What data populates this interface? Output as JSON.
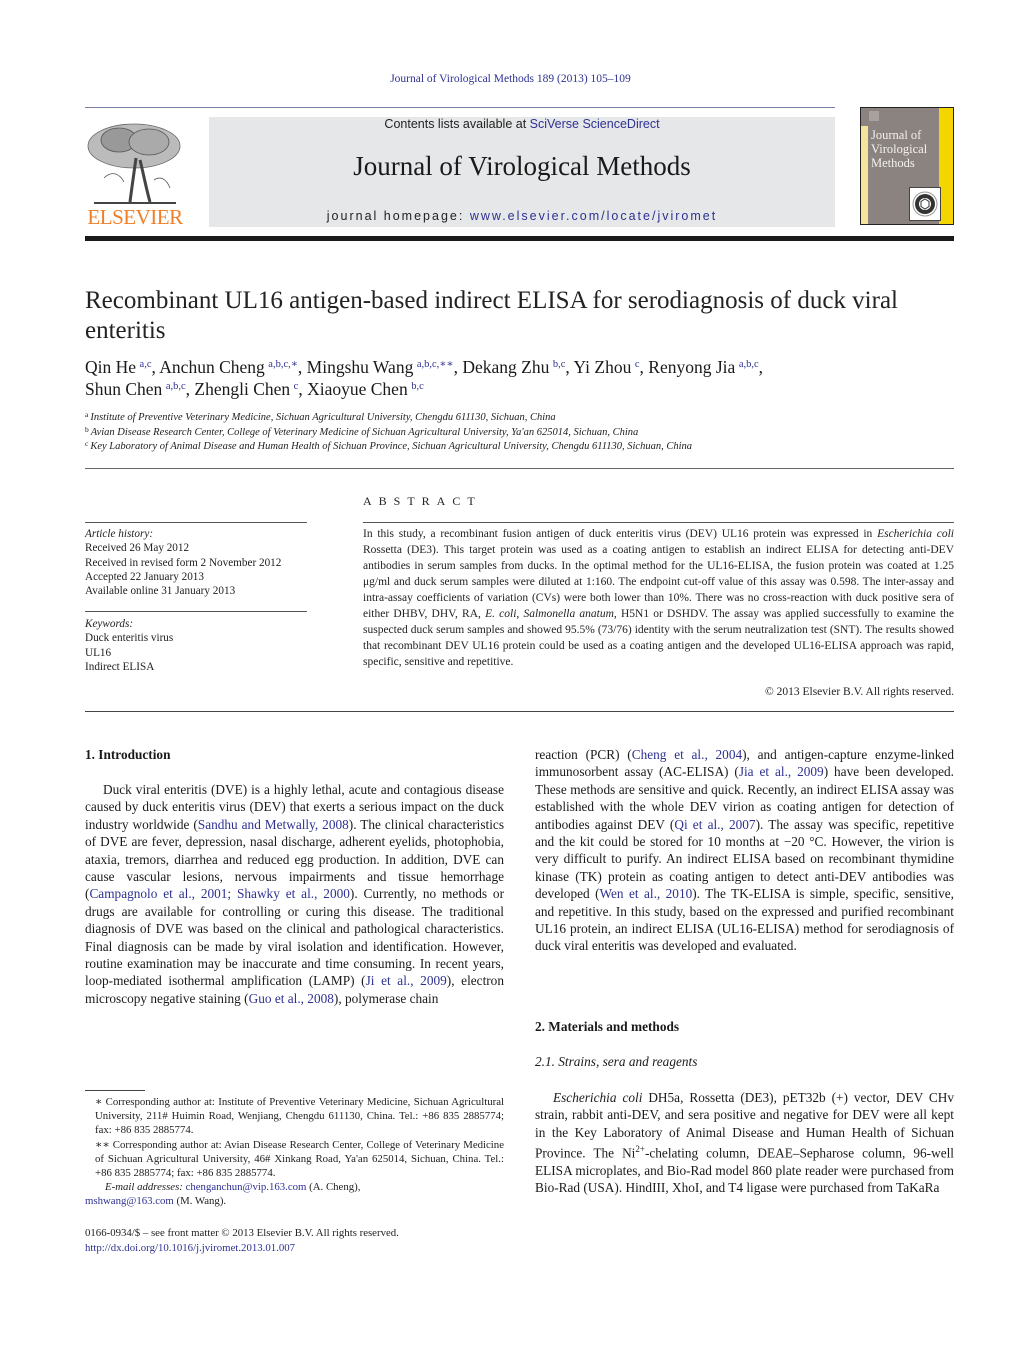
{
  "header": {
    "journal_ref": "Journal of Virological Methods 189 (2013) 105–109",
    "publisher_wordmark": "ELSEVIER",
    "contents_prefix": "Contents lists available at ",
    "contents_link": "SciVerse ScienceDirect",
    "journal_title": "Journal of Virological Methods",
    "homepage_prefix": "journal homepage: ",
    "homepage_url": "www.elsevier.com/locate/jviromet",
    "cover_title": "Journal of Virological Methods",
    "colors": {
      "link": "#2e3192",
      "elsevier_orange": "#f07e26",
      "masthead_bg": "#e6e7e8",
      "cover_yellow": "#f5d500"
    }
  },
  "article": {
    "title": "Recombinant UL16 antigen-based indirect ELISA for serodiagnosis of duck viral enteritis",
    "authors": [
      {
        "name": "Qin He",
        "sup": "a,c",
        "sep": ", "
      },
      {
        "name": "Anchun Cheng",
        "sup": "a,b,c,∗",
        "sep": ", "
      },
      {
        "name": "Mingshu Wang",
        "sup": "a,b,c,∗∗",
        "sep": ", "
      },
      {
        "name": "Dekang Zhu",
        "sup": "b,c",
        "sep": ", "
      },
      {
        "name": "Yi Zhou",
        "sup": "c",
        "sep": ", "
      },
      {
        "name": "Renyong Jia",
        "sup": "a,b,c",
        "sep": ", "
      },
      {
        "name": "Shun Chen",
        "sup": "a,b,c",
        "sep": ", "
      },
      {
        "name": "Zhengli Chen",
        "sup": "c",
        "sep": ", "
      },
      {
        "name": "Xiaoyue Chen",
        "sup": "b,c",
        "sep": ""
      }
    ],
    "affiliations": [
      {
        "key": "a",
        "text": "Institute of Preventive Veterinary Medicine, Sichuan Agricultural University, Chengdu 611130, Sichuan, China"
      },
      {
        "key": "b",
        "text": "Avian Disease Research Center, College of Veterinary Medicine of Sichuan Agricultural University, Ya'an 625014, Sichuan, China"
      },
      {
        "key": "c",
        "text": "Key Laboratory of Animal Disease and Human Health of Sichuan Province, Sichuan Agricultural University, Chengdu 611130, Sichuan, China"
      }
    ]
  },
  "article_info": {
    "history_label": "Article history:",
    "history": [
      "Received 26 May 2012",
      "Received in revised form 2 November 2012",
      "Accepted 22 January 2013",
      "Available online 31 January 2013"
    ],
    "keywords_label": "Keywords:",
    "keywords": [
      "Duck enteritis virus",
      "UL16",
      "Indirect ELISA"
    ]
  },
  "abstract": {
    "heading": "ABSTRACT",
    "text_1": "In this study, a recombinant fusion antigen of duck enteritis virus (DEV) UL16 protein was expressed in ",
    "text_1_italic": "Escherichia coli",
    "text_2": " Rossetta (DE3). This target protein was used as a coating antigen to establish an indirect ELISA for detecting anti-DEV antibodies in serum samples from ducks. In the optimal method for the UL16-ELISA, the fusion protein was coated at 1.25 μg/ml and duck serum samples were diluted at 1:160. The endpoint cut-off value of this assay was 0.598. The inter-assay and intra-assay coefficients of variation (CVs) were both lower than 10%. There was no cross-reaction with duck positive sera of either DHBV, DHV, RA, ",
    "text_2_italic_a": "E. coli",
    "text_2b": ", ",
    "text_2_italic_b": "Salmonella anatum",
    "text_3": ", H5N1 or DSHDV. The assay was applied successfully to examine the suspected duck serum samples and showed 95.5% (73/76) identity with the serum neutralization test (SNT). The results showed that recombinant DEV UL16 protein could be used as a coating antigen and the developed UL16-ELISA approach was rapid, specific, sensitive and repetitive.",
    "copyright": "© 2013 Elsevier B.V. All rights reserved."
  },
  "body": {
    "intro_heading": "1.  Introduction",
    "intro_p1_a": "Duck viral enteritis (DVE) is a highly lethal, acute and contagious disease caused by duck enteritis virus (DEV) that exerts a serious impact on the duck industry worldwide (",
    "cite_sandhu": "Sandhu and Metwally, 2008",
    "intro_p1_b": "). The clinical characteristics of DVE are fever, depression, nasal discharge, adherent eyelids, photophobia, ataxia, tremors, diarrhea and reduced egg production. In addition, DVE can cause vascular lesions, nervous impairments and tissue hemorrhage (",
    "cite_campagnolo": "Campagnolo et al., 2001; Shawky et al., 2000",
    "intro_p1_c": "). Currently, no methods or drugs are available for controlling or curing this disease. The traditional diagnosis of DVE was based on the clinical and pathological characteristics. Final diagnosis can be made by viral isolation and identification. However, routine examination may be inaccurate and time consuming. In recent years, loop-mediated isothermal amplification (LAMP) (",
    "cite_ji": "Ji et al., 2009",
    "intro_p1_d": "), electron microscopy negative staining (",
    "cite_guo": "Guo et al., 2008",
    "intro_p1_e": "), polymerase chain",
    "right_a": "reaction (PCR) (",
    "cite_cheng": "Cheng et al., 2004",
    "right_b": "), and antigen-capture enzyme-linked immunosorbent assay (AC-ELISA) (",
    "cite_jia": "Jia et al., 2009",
    "right_c": ") have been developed. These methods are sensitive and quick. Recently, an indirect ELISA assay was established with the whole DEV virion as coating antigen for detection of antibodies against DEV (",
    "cite_qi": "Qi et al., 2007",
    "right_d": "). The assay was specific, repetitive and the kit could be stored for 10 months at −20 °C. However, the virion is very difficult to purify. An indirect ELISA based on recombinant thymidine kinase (TK) protein as coating antigen to detect anti-DEV antibodies was developed (",
    "cite_wen": "Wen et al., 2010",
    "right_e": "). The TK-ELISA is simple, specific, sensitive, and repetitive. In this study, based on the expressed and purified recombinant UL16 protein, an indirect ELISA (UL16-ELISA) method for serodiagnosis of duck viral enteritis was developed and evaluated.",
    "mm_heading": "2.  Materials and methods",
    "sub21_heading": "2.1.  Strains, sera and reagents",
    "mm_p1_italic": "Escherichia coli",
    "mm_p1_a": " DH5a, Rossetta (DE3), pET32b (+) vector, DEV CHv strain, rabbit anti-DEV, and sera positive and negative for DEV were all kept in the Key Laboratory of Animal Disease and Human Health of Sichuan Province. The Ni",
    "mm_p1_sup": "2+",
    "mm_p1_b": "-chelating column, DEAE–Sepharose column, 96-well ELISA microplates, and Bio-Rad model 860 plate reader were purchased from Bio-Rad (USA). HindIII, XhoI, and T4 ligase were purchased from TaKaRa"
  },
  "footnotes": {
    "fn1": "∗ Corresponding author at: Institute of Preventive Veterinary Medicine, Sichuan Agricultural University, 211# Huimin Road, Wenjiang, Chengdu 611130, China. Tel.: +86 835 2885774; fax: +86 835 2885774.",
    "fn2": "∗∗ Corresponding author at: Avian Disease Research Center, College of Veterinary Medicine of Sichuan Agricultural University, 46# Xinkang Road, Ya'an 625014, Sichuan, China. Tel.: +86 835 2885774; fax: +86 835 2885774.",
    "email_label": "E-mail addresses:",
    "email_1": "chenganchun@vip.163.com",
    "email_1_who": " (A. Cheng),",
    "email_2": "mshwang@163.com",
    "email_2_who": " (M. Wang).",
    "front_matter": "0166-0934/$ – see front matter © 2013 Elsevier B.V. All rights reserved.",
    "doi": "http://dx.doi.org/10.1016/j.jviromet.2013.01.007"
  }
}
